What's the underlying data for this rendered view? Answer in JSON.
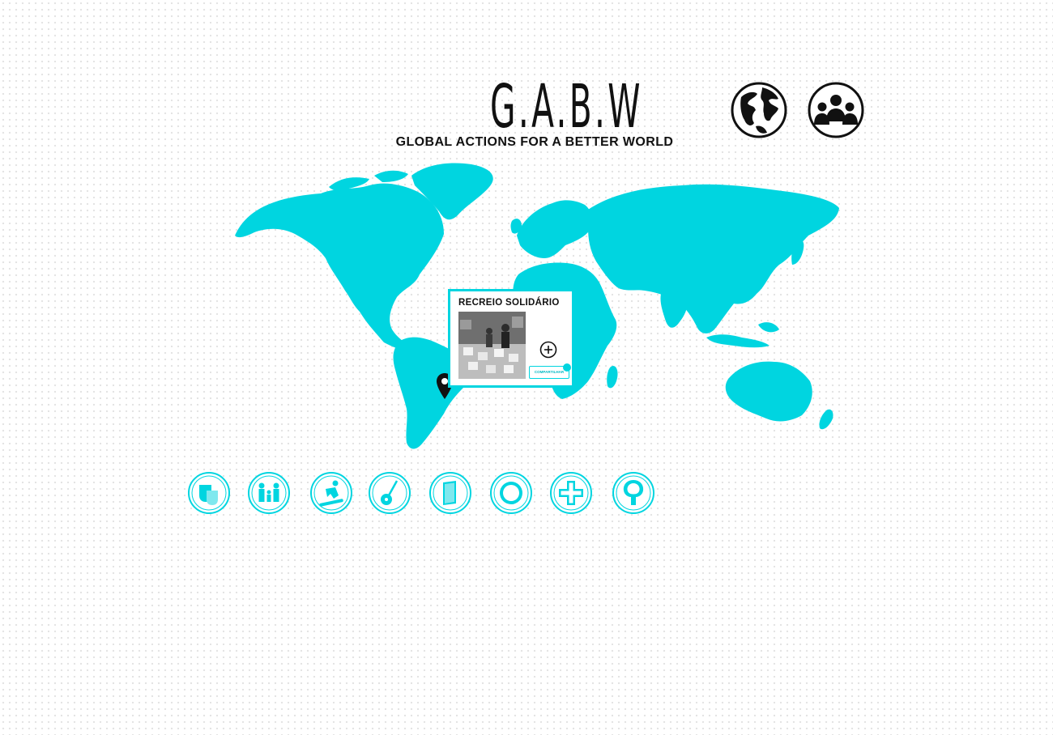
{
  "header": {
    "logo_title": "G.A.B.W",
    "logo_subtitle": "GLOBAL ACTIONS FOR A BETTER WORLD",
    "buttons": [
      {
        "icon": "globe-icon"
      },
      {
        "icon": "people-group-icon"
      }
    ]
  },
  "colors": {
    "accent": "#00d5e0",
    "ink": "#111111"
  },
  "map": {
    "marker": {
      "icon": "map-pin-icon",
      "popup": {
        "title": "RECREIO SOLIDÁRIO",
        "more_icon": "plus-circle-icon",
        "share_label": "COMPARTILHAR"
      }
    }
  },
  "categories": [
    {
      "icon": "theater-masks-icon"
    },
    {
      "icon": "family-icon"
    },
    {
      "icon": "snowboard-icon"
    },
    {
      "icon": "guitar-icon"
    },
    {
      "icon": "book-icon"
    },
    {
      "icon": "plate-icon"
    },
    {
      "icon": "health-cross-icon"
    },
    {
      "icon": "tree-icon"
    }
  ]
}
